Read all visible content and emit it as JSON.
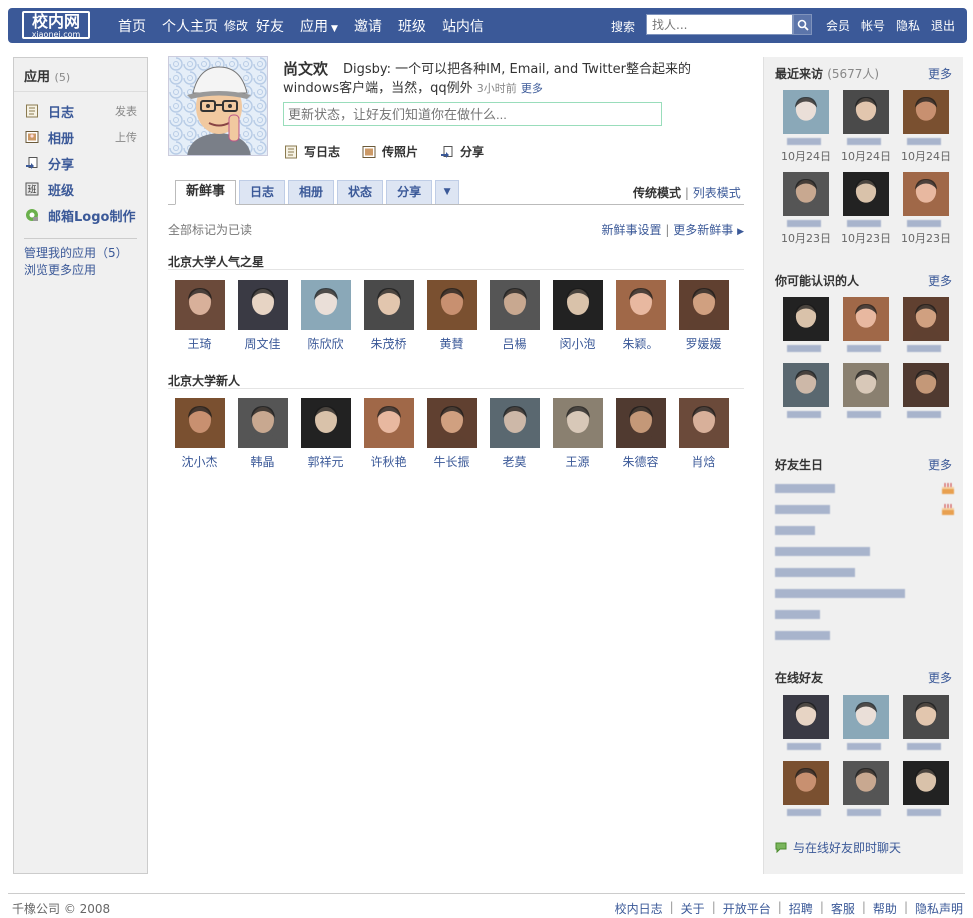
{
  "topbar": {
    "logo_cn": "校内网",
    "logo_en": "xiaonei.com",
    "nav": [
      "首页",
      "个人主页",
      "修改",
      "好友",
      "应用",
      "邀请",
      "班级",
      "站内信"
    ],
    "search_label": "搜索",
    "search_placeholder": "找人...",
    "right_nav": [
      "会员",
      "帐号",
      "隐私",
      "退出"
    ]
  },
  "left": {
    "apps_title": "应用",
    "apps_count": "(5)",
    "apps": [
      {
        "label": "日志",
        "action": "发表",
        "icon": "journal-icon"
      },
      {
        "label": "相册",
        "action": "上传",
        "icon": "photo-album-icon"
      },
      {
        "label": "分享",
        "action": "",
        "icon": "share-icon"
      },
      {
        "label": "班级",
        "action": "",
        "icon": "class-icon"
      },
      {
        "label": "邮箱Logo制作",
        "action": "",
        "icon": "mail-logo-icon"
      }
    ],
    "manage_apps": "管理我的应用（5）",
    "browse_apps": "浏览更多应用"
  },
  "profile": {
    "name": "尚文欢",
    "status": "Digsby: 一个可以把各种IM, Email, and Twitter整合起来的windows客户端，当然，qq例外",
    "time": "3小时前",
    "more": "更多",
    "status_placeholder": "更新状态，让好友们知道你在做什么...",
    "quick_actions": [
      "写日志",
      "传照片",
      "分享"
    ]
  },
  "tabs": [
    "新鲜事",
    "日志",
    "相册",
    "状态",
    "分享"
  ],
  "view_modes": {
    "traditional": "传统模式",
    "sep": "|",
    "list": "列表模式"
  },
  "feed": {
    "mark_read": "全部标记为已读",
    "settings": "新鲜事设置",
    "sep": "|",
    "more": "更多新鲜事"
  },
  "stars": {
    "title": "北京大学人气之星",
    "people": [
      "王琦",
      "周文佳",
      "陈欣欣",
      "朱茂桥",
      "黄賛",
      "吕楊",
      "闵小泡",
      "朱颖。",
      "罗媛媛"
    ]
  },
  "newcomers": {
    "title": "北京大学新人",
    "people": [
      "沈小杰",
      "韩晶",
      "郭祥元",
      "许秋艳",
      "牛长振",
      "老莫",
      "王源",
      "朱德容",
      "肖焓"
    ]
  },
  "right": {
    "visitors_title": "最近来访",
    "visitors_count": "(5677人)",
    "visitors_more": "更多",
    "visitor_dates": [
      "10月24日",
      "10月24日",
      "10月24日",
      "10月23日",
      "10月23日",
      "10月23日"
    ],
    "may_know_title": "你可能认识的人",
    "may_know_more": "更多",
    "birthday_title": "好友生日",
    "birthday_more": "更多",
    "online_title": "在线好友",
    "online_more": "更多",
    "chat_link": "与在线好友即时聊天"
  },
  "footer": {
    "copyright": "千橡公司 © 2008",
    "links": [
      "校内日志",
      "关于",
      "开放平台",
      "招聘",
      "客服",
      "帮助",
      "隐私声明"
    ]
  }
}
